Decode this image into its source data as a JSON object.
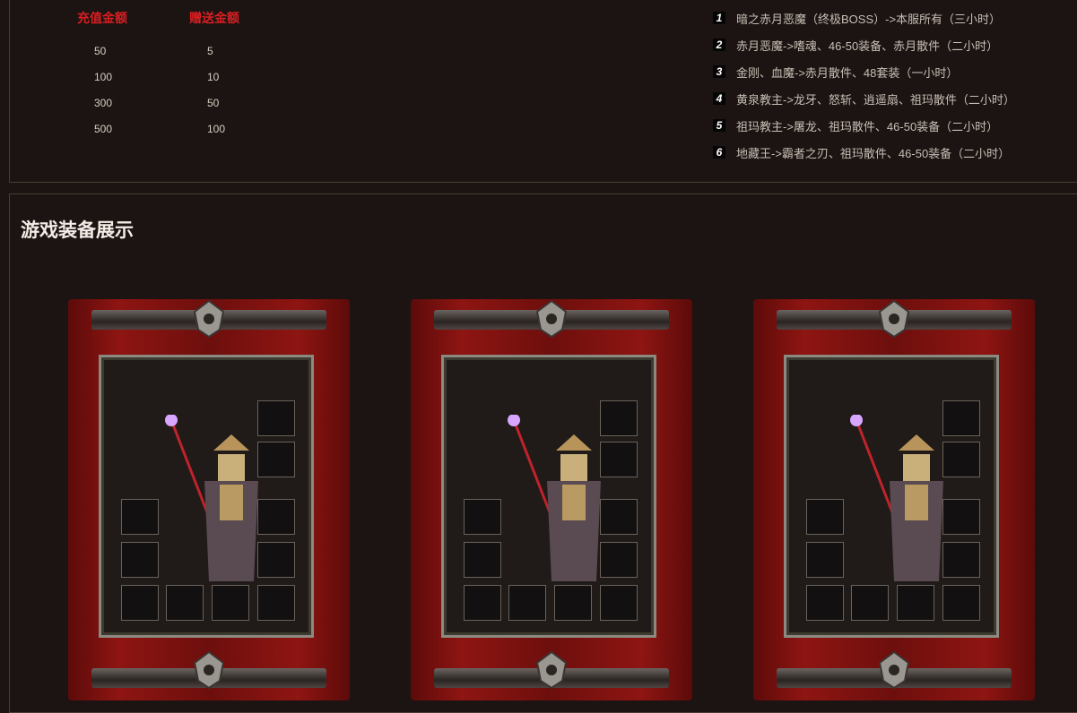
{
  "recharge": {
    "headers": [
      "充值金额",
      "赠送金额"
    ],
    "rows": [
      [
        "50",
        "5"
      ],
      [
        "100",
        "10"
      ],
      [
        "300",
        "50"
      ],
      [
        "500",
        "100"
      ]
    ]
  },
  "bosses": [
    {
      "num": "1",
      "text": "暗之赤月恶魔（终极BOSS）->本服所有（三小时）"
    },
    {
      "num": "2",
      "text": "赤月恶魔->嗜魂、46-50装备、赤月散件（二小时）"
    },
    {
      "num": "3",
      "text": "金刚、血魔->赤月散件、48套装（一小时）"
    },
    {
      "num": "4",
      "text": "黄泉教主->龙牙、怒斩、逍遥扇、祖玛散件（二小时）"
    },
    {
      "num": "5",
      "text": "祖玛教主->屠龙、祖玛散件、46-50装备（二小时）"
    },
    {
      "num": "6",
      "text": "地藏王->霸者之刃、祖玛散件、46-50装备（二小时）"
    }
  ],
  "showcase": {
    "title": "游戏装备展示"
  },
  "colors": {
    "accent_red": "#d91e22",
    "banner_red": "#8e1512",
    "background": "#1b1412",
    "border": "#4a3d35"
  }
}
